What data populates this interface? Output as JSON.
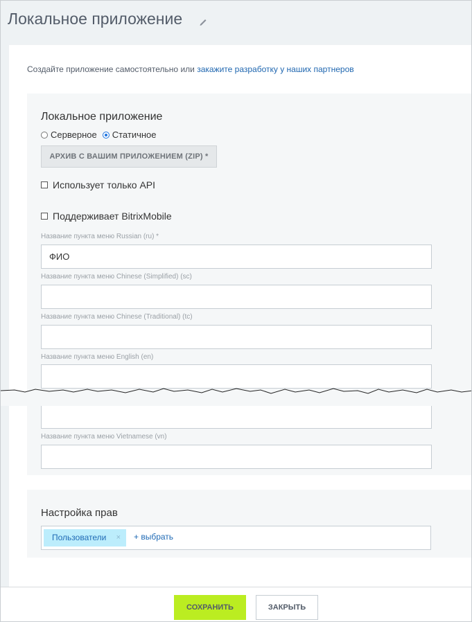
{
  "header": {
    "title": "Локальное приложение"
  },
  "intro": {
    "text": "Создайте приложение самостоятельно или ",
    "link": "закажите разработку у наших партнеров"
  },
  "app_section": {
    "title": "Локальное приложение",
    "radio_options": [
      {
        "label": "Серверное",
        "selected": false
      },
      {
        "label": "Статичное",
        "selected": true
      }
    ],
    "zip_button": "АРХИВ С ВАШИМ ПРИЛОЖЕНИЕМ (ZIP) *",
    "checkboxes": [
      {
        "label": "Использует только API",
        "checked": false
      },
      {
        "label": "Поддерживает BitrixMobile",
        "checked": false
      }
    ],
    "menu_fields": [
      {
        "label": "Название пункта меню Russian (ru) *",
        "value": "ФИО"
      },
      {
        "label": "Название пункта меню Chinese (Simplified) (sc)",
        "value": ""
      },
      {
        "label": "Название пункта меню Chinese (Traditional) (tc)",
        "value": ""
      },
      {
        "label": "Название пункта меню English (en)",
        "value": ""
      },
      {
        "label": "",
        "value": ""
      },
      {
        "label": "Название пункта меню Vietnamese (vn)",
        "value": ""
      }
    ]
  },
  "rights": {
    "title": "Настройка прав",
    "tag": "Пользователи",
    "tag_remove": "×",
    "add_link": "+ выбрать"
  },
  "footer": {
    "save": "СОХРАНИТЬ",
    "close": "ЗАКРЫТЬ"
  },
  "colors": {
    "accent": "#bbed21",
    "link": "#2067b0",
    "tag_bg": "#bcedfc"
  }
}
